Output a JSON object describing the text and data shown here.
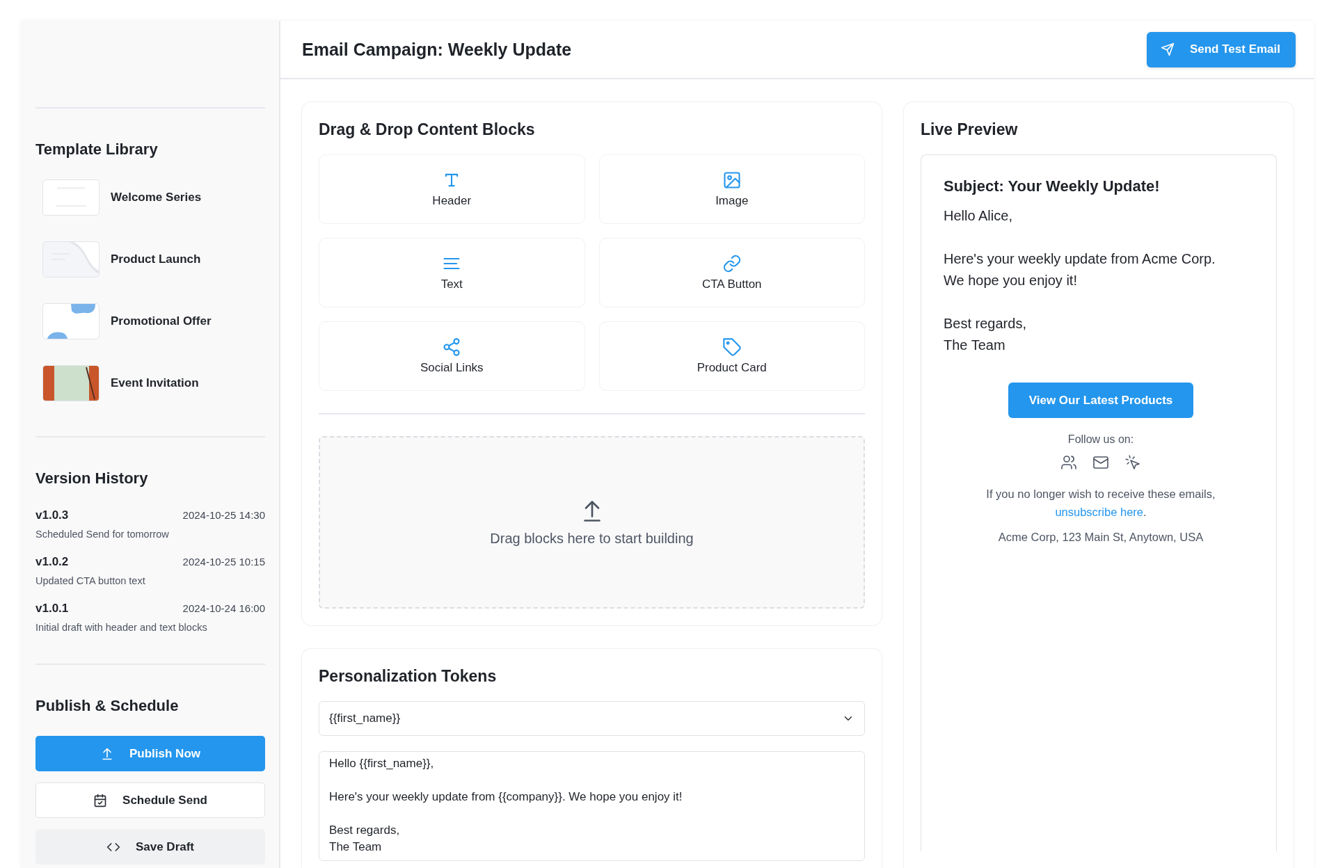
{
  "template_library": {
    "title": "Template Library",
    "items": [
      {
        "name": "Welcome Series",
        "kind": "plain"
      },
      {
        "name": "Product Launch",
        "kind": "wave"
      },
      {
        "name": "Promotional Offer",
        "kind": "blobs"
      },
      {
        "name": "Event Invitation",
        "kind": "photo"
      }
    ]
  },
  "version_history": {
    "title": "Version History",
    "versions": [
      {
        "version": "v1.0.3",
        "timestamp": "2024-10-25 14:30",
        "note": "Scheduled Send for tomorrow"
      },
      {
        "version": "v1.0.2",
        "timestamp": "2024-10-25 10:15",
        "note": "Updated CTA button text"
      },
      {
        "version": "v1.0.1",
        "timestamp": "2024-10-24 16:00",
        "note": "Initial draft with header and text blocks"
      }
    ]
  },
  "publish": {
    "title": "Publish & Schedule",
    "buttons": [
      {
        "label": "Publish Now",
        "kind": "primary"
      },
      {
        "label": "Schedule Send",
        "kind": "outline"
      },
      {
        "label": "Save Draft",
        "kind": "muted"
      }
    ]
  },
  "header": {
    "title": "Email Campaign: Weekly Update",
    "button": {
      "label": "Send Test Email"
    }
  },
  "content_blocks": {
    "title": "Drag & Drop Content Blocks",
    "blocks": [
      {
        "label": "Header",
        "kind": "header"
      },
      {
        "label": "Image",
        "kind": "image"
      },
      {
        "label": "Text",
        "kind": "text"
      },
      {
        "label": "CTA Button",
        "kind": "link"
      },
      {
        "label": "Social Links",
        "kind": "share"
      },
      {
        "label": "Product Card",
        "kind": "tag"
      }
    ],
    "dropzone": {
      "text": "Drag blocks here to start building"
    }
  },
  "tokens": {
    "title": "Personalization Tokens",
    "select": {
      "value": "{{first_name}}"
    },
    "editor": {
      "value": "Hello {{first_name}},\n\nHere's your weekly update from {{company}}. We hope you enjoy it!\n\nBest regards,\nThe Team"
    }
  },
  "preview": {
    "title": "Live Preview",
    "subject": "Subject: Your Weekly Update!",
    "paragraphs": [
      [
        "Hello Alice,"
      ],
      [
        "Here's your weekly update from Acme Corp.",
        "We hope you enjoy it!"
      ],
      [
        "Best regards,",
        "The Team"
      ]
    ],
    "cta": "View Our Latest Products",
    "follow_label": "Follow us on:",
    "social": [
      {
        "kind": "people"
      },
      {
        "kind": "mail"
      },
      {
        "kind": "click"
      }
    ],
    "unsubscribe_prefix": "If you no longer wish to receive these emails,",
    "unsubscribe_link": "unsubscribe here",
    "unsubscribe_suffix": ".",
    "address": "Acme Corp, 123 Main St, Anytown, USA"
  }
}
